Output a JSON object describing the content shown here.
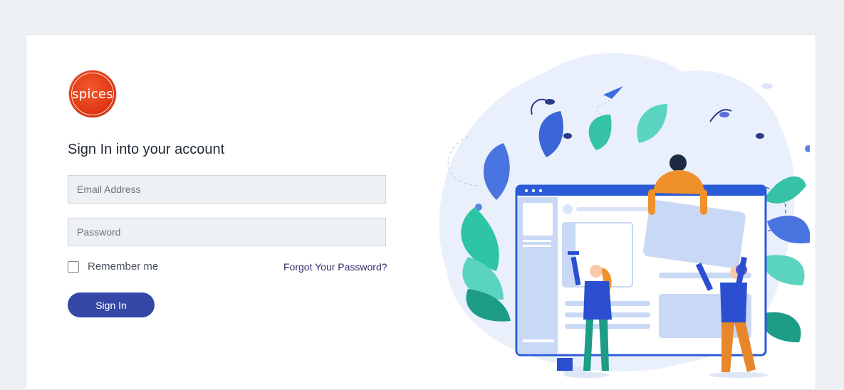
{
  "brand": {
    "logo_text": "spices"
  },
  "form": {
    "heading": "Sign In into your account",
    "email_placeholder": "Email Address",
    "password_placeholder": "Password",
    "remember_label": "Remember me",
    "forgot_label": "Forgot Your Password?",
    "signin_label": "Sign In"
  },
  "colors": {
    "background": "#eef1f4",
    "primary_button": "#3548a8",
    "logo": "#e43a16"
  }
}
